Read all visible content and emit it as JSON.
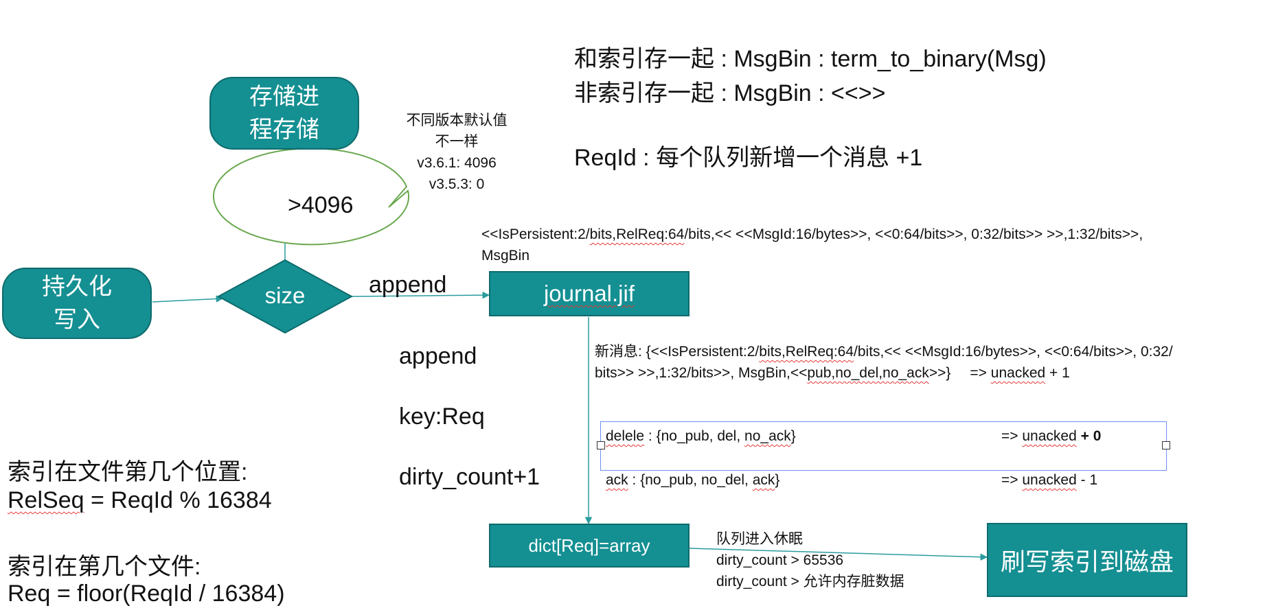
{
  "nodes": {
    "persist": {
      "line1": "持久化",
      "line2": "写入"
    },
    "storage": {
      "line1": "存储进",
      "line2": "程存储"
    },
    "size": "size",
    "journal": "journal.jif",
    "dict": "dict[Req]=array",
    "flush": "刷写索引到磁盘"
  },
  "callout": {
    "line1": "不同版本默认值",
    "line2": "不一样",
    "line3": "v3.6.1: 4096",
    "line4": "v3.5.3: 0"
  },
  "labels": {
    "gt4096": ">4096",
    "append_top": "append",
    "append_side": "append",
    "key_req": "key:Req",
    "dirty_count": "dirty_count+1"
  },
  "notes_top": {
    "line1": "和索引存一起 : MsgBin : term_to_binary(Msg)",
    "line2": "非索引存一起 : MsgBin : <<>>",
    "reqid": "ReqId : 每个队列新增一个消息 +1"
  },
  "format_line": {
    "prefix": "<<IsPersistent:2/",
    "s1": "bits,RelReq:64",
    "mid": "/bits,<< <<MsgId:16/bytes>>, <<0:64/bits>>, 0:32/bits>> >>,1:32/bits>>,",
    "line2": "MsgBin"
  },
  "new_msg": {
    "a": "新消息: {<<IsPersistent:2/",
    "b": "bits,RelReq:64",
    "c": "/bits,<< <<MsgId:16/bytes>>, <<0:64/bits>>, 0:32/",
    "d": "bits>> >>,1:32/bits>>, MsgBin,<<",
    "e": "pub,no_del,no_ack",
    "f": ">>}",
    "g": "=> ",
    "h": "unacked",
    "i": " + 1"
  },
  "delele": {
    "a": "delele",
    "b": " : {no_pub,    del, ",
    "c": "no_ack",
    "d": "}",
    "e": "=> ",
    "f": "unacked",
    "g": " + 0"
  },
  "ack": {
    "a": "ack",
    "b": " : {no_pub, no_del,    ",
    "c": "ack",
    "d": "}",
    "e": "=> ",
    "f": "unacked",
    "g": " - 1"
  },
  "sleep_note": {
    "line1": "队列进入休眠",
    "line2": "dirty_count > 65536",
    "line3": "dirty_count > 允许内存脏数据"
  },
  "index_notes": {
    "pos_title": "索引在文件第几个位置:",
    "pos_a": "RelSeq",
    "pos_b": " = ReqId % 16384",
    "file_title": "索引在第几个文件:",
    "file_formula": "Req = floor(ReqId / 16384)"
  },
  "colors": {
    "node_fill": "#148f92",
    "node_border": "#0e6b6d",
    "connector": "#2a9c9e",
    "callout_border": "#6aa84f",
    "selection_box": "#6d8ff0",
    "spell_underline": "#e53935"
  }
}
